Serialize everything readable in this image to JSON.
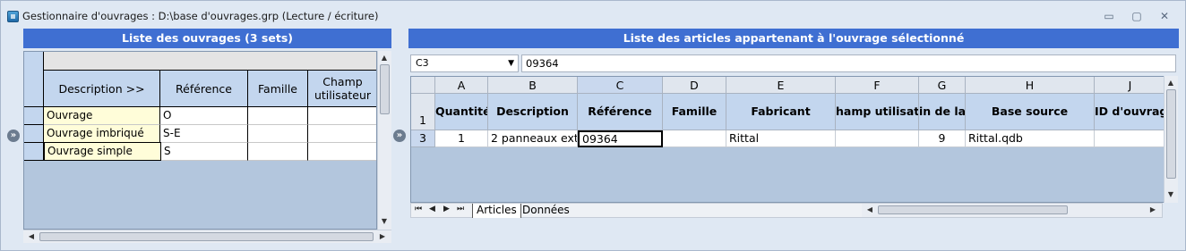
{
  "window": {
    "title": "Gestionnaire d'ouvrages : D:\\base d'ouvrages.grp (Lecture / écriture)",
    "btn_minimize": "▭",
    "btn_restore": "▢",
    "btn_close": "✕"
  },
  "left_panel": {
    "header": "Liste des ouvrages (3 sets)",
    "columns": [
      "Description >>",
      "Référence",
      "Famille",
      "Champ utilisateur"
    ],
    "rows": [
      {
        "description": "Ouvrage",
        "reference": "O",
        "famille": "",
        "champ": ""
      },
      {
        "description": "Ouvrage imbriqué",
        "reference": "S-E",
        "famille": "",
        "champ": ""
      },
      {
        "description": "Ouvrage simple",
        "reference": "S",
        "famille": "",
        "champ": ""
      }
    ]
  },
  "right_panel": {
    "header": "Liste des articles appartenant à l'ouvrage sélectionné",
    "name_box": "C3",
    "formula_value": "09364",
    "column_letters": [
      "A",
      "B",
      "C",
      "D",
      "E",
      "F",
      "G",
      "H",
      "J"
    ],
    "row_numbers": [
      "1",
      "3"
    ],
    "header_cells": [
      "Quantité",
      "Description",
      "Référence",
      "Famille",
      "Fabricant",
      "hamp utilisate",
      "in de la",
      "Base source",
      "ID d'ouvrage"
    ],
    "data_row": [
      "1",
      "2 panneaux ext",
      "09364",
      "",
      "Rittal",
      "",
      "9",
      "Rittal.qdb",
      ""
    ],
    "sheet_tabs": [
      "Articles",
      "Données"
    ],
    "active_tab": "Articles"
  },
  "icons": {
    "expand_left": "»",
    "expand_right": "»",
    "nav_first": "⏮",
    "nav_prev": "◀",
    "nav_next": "▶",
    "nav_last": "⏭"
  }
}
